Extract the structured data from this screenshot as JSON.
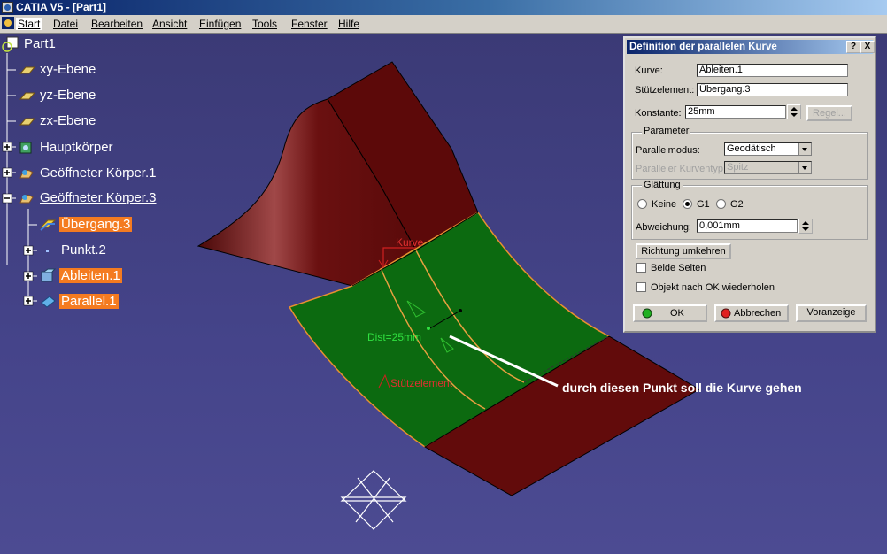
{
  "window": {
    "title": "CATIA V5 - [Part1]"
  },
  "menu": [
    "Start",
    "Datei",
    "Bearbeiten",
    "Ansicht",
    "Einfügen",
    "Tools",
    "Fenster",
    "Hilfe"
  ],
  "tree": {
    "root": "Part1",
    "items": [
      {
        "label": "xy-Ebene",
        "icon": "plane-icon"
      },
      {
        "label": "yz-Ebene",
        "icon": "plane-icon"
      },
      {
        "label": "zx-Ebene",
        "icon": "plane-icon"
      },
      {
        "label": "Hauptkörper",
        "icon": "body-icon"
      },
      {
        "label": "Geöffneter Körper.1",
        "icon": "open-body-icon"
      },
      {
        "label": "Geöffneter Körper.3",
        "icon": "open-body-icon"
      },
      {
        "label": "Übergang.3",
        "icon": "blend-surface-icon"
      },
      {
        "label": "Punkt.2",
        "icon": "point-icon"
      },
      {
        "label": "Ableiten.1",
        "icon": "extract-icon"
      },
      {
        "label": "Parallel.1",
        "icon": "parallel-curve-icon"
      }
    ]
  },
  "viewport": {
    "labels": {
      "kurve": "Kurve",
      "dist": "Dist=25mm",
      "stuetz": "Stützelement"
    },
    "annotation": "durch diesen Punkt soll die Kurve gehen"
  },
  "dialog": {
    "title": "Definition der parallelen Kurve",
    "help_btn": "?",
    "close_btn": "X",
    "kurve_label": "Kurve:",
    "kurve_value": "Ableiten.1",
    "stuetz_label": "Stützelement:",
    "stuetz_value": "Übergang.3",
    "konstante_label": "Konstante:",
    "konstante_value": "25mm",
    "regel_btn": "Regel...",
    "parameter_group": "Parameter",
    "parallelmodus_label": "Parallelmodus:",
    "parallelmodus_value": "Geodätisch",
    "kurventyp_label": "Paralleler Kurventyp:",
    "kurventyp_value": "Spitz",
    "glaettung_group": "Glättung",
    "keine_label": "Keine",
    "g1_label": "G1",
    "g2_label": "G2",
    "abweichung_label": "Abweichung:",
    "abweichung_value": "0,001mm",
    "richtung_btn": "Richtung umkehren",
    "beide_label": "Beide Seiten",
    "objekt_label": "Objekt nach OK wiederholen",
    "ok_btn": "OK",
    "abbrechen_btn": "Abbrechen",
    "voranzeige_btn": "Voranzeige"
  },
  "colors": {
    "background": "#3e3d7a",
    "surface_red": "#6b0f0f",
    "surface_green": "#0f6b12",
    "highlight": "#f47b20",
    "curve": "#e8a040"
  }
}
